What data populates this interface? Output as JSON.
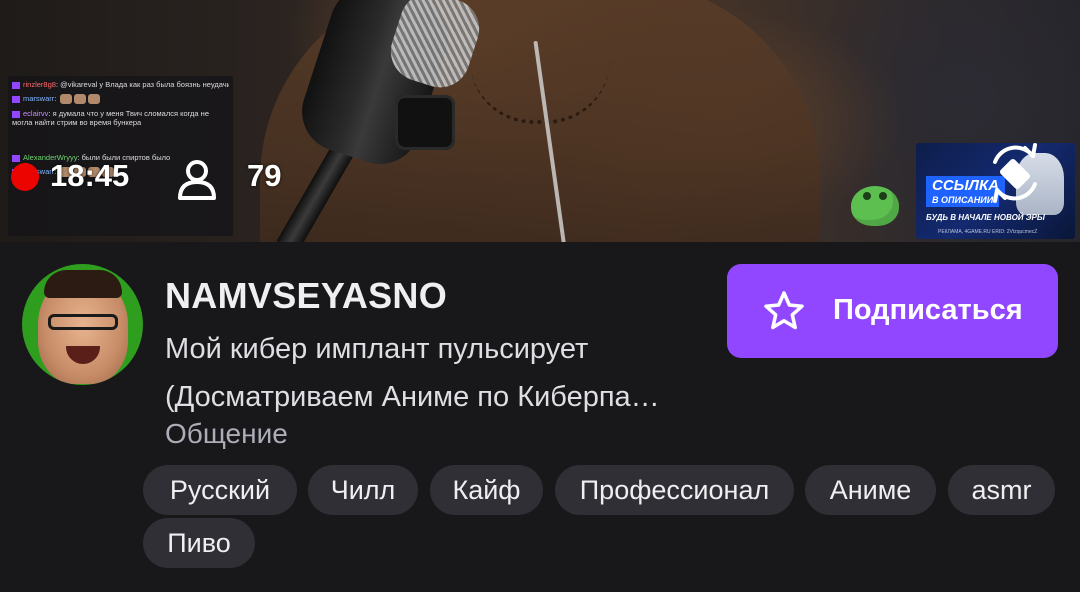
{
  "video": {
    "chat_messages": [
      {
        "user": "rinzler8g8",
        "text": "@vikareval у Влада как раз была боязнь неудачи"
      },
      {
        "user": "marswarr",
        "text": ""
      },
      {
        "user": "eclairvv",
        "text": "я думала что у меня Твич сломался когда не могла найти стрим во время бункера"
      },
      {
        "user": "AlexanderWryyy",
        "text": "были были  спиртов было"
      },
      {
        "user": "marswarr",
        "text": ""
      }
    ],
    "live_time": "18:45",
    "viewer_count": "79",
    "ad": {
      "title": "ССЫЛКА",
      "subtitle": "В ОПИСАНИИ",
      "slogan": "БУДЬ В НАЧАЛЕ НОВОЙ ЭРЫ",
      "legal": "РЕКЛАМА, 4GAME.RU ERID: 2VtzqucmecZ"
    },
    "icons": {
      "viewer": "person-icon",
      "rotate": "rotate-screen-icon",
      "live": "record-dot-icon"
    }
  },
  "channel": {
    "name": "NAMVSEYASNO",
    "title_line1": "Мой кибер имплант пульсирует",
    "title_line2": "(Досматриваем Аниме по Киберпа…",
    "category": "Общение",
    "avatar_bg": "#2f9e1f"
  },
  "subscribe": {
    "label": "Подписаться",
    "color": "#9147ff",
    "icon": "star-icon"
  },
  "tags": [
    "Русский",
    "Чилл",
    "Кайф",
    "Профессионал",
    "Аниме",
    "asmr",
    "Пиво"
  ]
}
